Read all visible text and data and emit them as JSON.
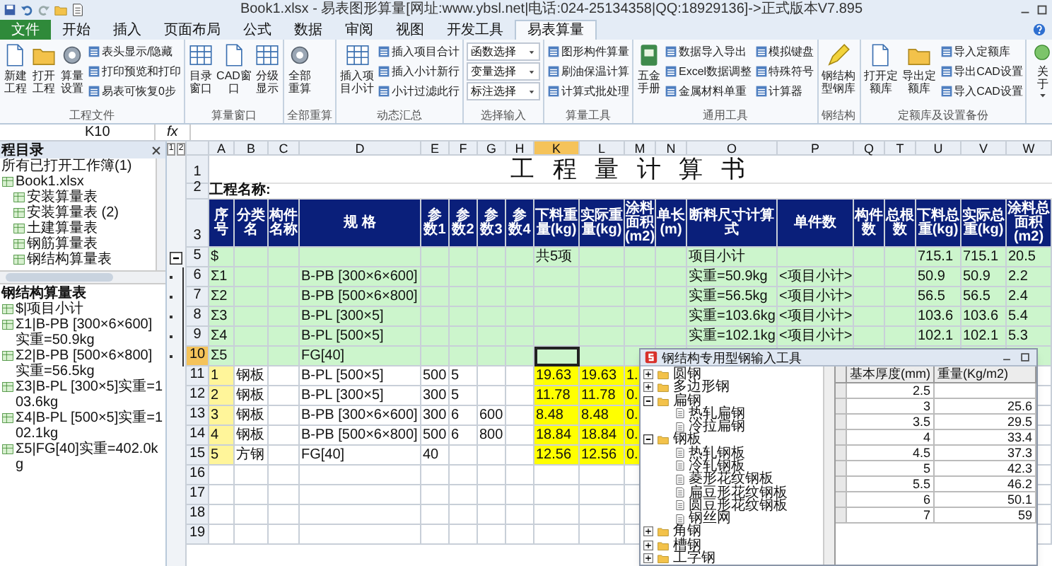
{
  "window": {
    "title": "Book1.xlsx - 易表图形算量[网址:www.ybsl.net|电话:024-25134358|QQ:18929136]->正式版本V7.895"
  },
  "tabs": [
    {
      "label": "文件",
      "kind": "file",
      "selected": false
    },
    {
      "label": "开始",
      "kind": "tab",
      "selected": false
    },
    {
      "label": "插入",
      "kind": "tab",
      "selected": false
    },
    {
      "label": "页面布局",
      "kind": "tab",
      "selected": false
    },
    {
      "label": "公式",
      "kind": "tab",
      "selected": false
    },
    {
      "label": "数据",
      "kind": "tab",
      "selected": false
    },
    {
      "label": "审阅",
      "kind": "tab",
      "selected": false
    },
    {
      "label": "视图",
      "kind": "tab",
      "selected": false
    },
    {
      "label": "开发工具",
      "kind": "tab",
      "selected": false
    },
    {
      "label": "易表算量",
      "kind": "tab",
      "selected": true
    }
  ],
  "ribbon": [
    {
      "label": "工程文件",
      "items": [
        {
          "kind": "large",
          "label": "新建工程"
        },
        {
          "kind": "large",
          "label": "打开工程"
        },
        {
          "kind": "large",
          "label": "算量设置"
        },
        {
          "kind": "small",
          "label": "表头显示/隐藏"
        },
        {
          "kind": "small",
          "label": "打印预览和打印"
        },
        {
          "kind": "small",
          "label": "易表可恢复0步"
        }
      ]
    },
    {
      "label": "算量窗口",
      "items": [
        {
          "kind": "large",
          "label": "目录窗口"
        },
        {
          "kind": "large",
          "label": "CAD窗口"
        },
        {
          "kind": "large",
          "label": "分级显示"
        }
      ]
    },
    {
      "label": "全部重算",
      "items": [
        {
          "kind": "large",
          "label": "全部重算"
        }
      ]
    },
    {
      "label": "动态汇总",
      "items": [
        {
          "kind": "large",
          "label": "插入项目小计"
        },
        {
          "kind": "small",
          "label": "插入项目合计"
        },
        {
          "kind": "small",
          "label": "插入小计新行"
        },
        {
          "kind": "small",
          "label": "小计过滤此行"
        }
      ]
    },
    {
      "label": "选择输入",
      "items": [
        {
          "kind": "select",
          "label": "函数选择"
        },
        {
          "kind": "select",
          "label": "变量选择"
        },
        {
          "kind": "select",
          "label": "标注选择"
        }
      ]
    },
    {
      "label": "算量工具",
      "items": [
        {
          "kind": "small",
          "label": "图形构件算量"
        },
        {
          "kind": "small",
          "label": "刷油保温计算"
        },
        {
          "kind": "small",
          "label": "计算式批处理"
        }
      ]
    },
    {
      "label": "通用工具",
      "items": [
        {
          "kind": "large",
          "label": "五金手册"
        },
        {
          "kind": "small",
          "label": "数据导入导出"
        },
        {
          "kind": "small",
          "label": "Excel数据调整"
        },
        {
          "kind": "small",
          "label": "金属材料单重"
        },
        {
          "kind": "small",
          "label": "模拟键盘"
        },
        {
          "kind": "small",
          "label": "特殊符号"
        },
        {
          "kind": "small",
          "label": "计算器"
        }
      ]
    },
    {
      "label": "钢结构",
      "items": [
        {
          "kind": "large",
          "label": "钢结构型钢库"
        }
      ]
    },
    {
      "label": "定额库及设置备份",
      "items": [
        {
          "kind": "large",
          "label": "打开定额库"
        },
        {
          "kind": "large",
          "label": "导出定额库"
        },
        {
          "kind": "small",
          "label": "导入定额库"
        },
        {
          "kind": "small",
          "label": "导出CAD设置"
        },
        {
          "kind": "small",
          "label": "导入CAD设置"
        }
      ]
    },
    {
      "items": [
        {
          "kind": "menu",
          "label": "关于"
        }
      ]
    }
  ],
  "formula_bar": {
    "name_box": "K10",
    "fx": "fx"
  },
  "panel": {
    "title": "程目录",
    "tree": {
      "label": "所有已打开工作簿(1)",
      "children": [
        {
          "label": "Book1.xlsx",
          "children": [
            {
              "label": "安装算量表"
            },
            {
              "label": "安装算量表 (2)"
            },
            {
              "label": "土建算量表"
            },
            {
              "label": "钢筋算量表"
            },
            {
              "label": "钢结构算量表"
            }
          ]
        }
      ]
    },
    "list_title": "钢结构算量表",
    "list": [
      "$|项目小计",
      "Σ1|B-PB [300×6×600]实重=50.9kg",
      "Σ2|B-PB [500×6×800]实重=56.5kg",
      "Σ3|B-PL [300×5]实重=103.6kg",
      "Σ4|B-PL [500×5]实重=102.1kg",
      "Σ5|FG[40]实重=402.0kg"
    ]
  },
  "outline": {
    "levels": [
      "1",
      "2"
    ]
  },
  "sheet": {
    "columns": [
      {
        "letter": "A",
        "selected": false
      },
      {
        "letter": "B",
        "selected": false
      },
      {
        "letter": "C",
        "selected": false
      },
      {
        "letter": "D",
        "selected": false
      },
      {
        "letter": "E",
        "selected": false
      },
      {
        "letter": "F",
        "selected": false
      },
      {
        "letter": "G",
        "selected": false
      },
      {
        "letter": "H",
        "selected": false
      },
      {
        "letter": "K",
        "selected": true
      },
      {
        "letter": "L",
        "selected": false
      },
      {
        "letter": "M",
        "selected": false
      },
      {
        "letter": "N",
        "selected": false
      },
      {
        "letter": "O",
        "selected": false
      },
      {
        "letter": "P",
        "selected": false
      },
      {
        "letter": "Q",
        "selected": false
      },
      {
        "letter": "T",
        "selected": false
      },
      {
        "letter": "U",
        "selected": false
      },
      {
        "letter": "V",
        "selected": false
      },
      {
        "letter": "W",
        "selected": false
      }
    ],
    "rows": [
      {
        "number": "1",
        "kind": "title",
        "selected": false,
        "text": "工 程 量 计 算 书"
      },
      {
        "number": "2",
        "kind": "project",
        "selected": false,
        "text": "工程名称:"
      },
      {
        "number": "3",
        "kind": "header",
        "selected": false,
        "cells": {
          "A": "序号",
          "B": "分类名",
          "C": "构件名称",
          "D": "规 格",
          "E": "参数1",
          "F": "参数2",
          "G": "参数3",
          "H": "参数4",
          "K": "下料重量(kg)",
          "L": "实际重量(kg)",
          "M": "涂料面积(m2)",
          "N": "单长(m)",
          "O": "断料尺寸计算式",
          "P": "单件数",
          "Q": "构件数",
          "T": "总根数",
          "U": "下料总重(kg)",
          "V": "实际总重(kg)",
          "W": "涂料总面积(m2)"
        }
      },
      {
        "number": "5",
        "kind": "summary",
        "selected": false,
        "cells": {
          "A": "$",
          "K": "共5项",
          "O": "项目小计",
          "U": "715.1",
          "V": "715.1",
          "W": "20.5"
        }
      },
      {
        "number": "6",
        "kind": "summary",
        "selected": false,
        "cells": {
          "A": "Σ1",
          "D": "B-PB [300×6×600]",
          "O": "实重=50.9kg",
          "P": "<项目小计>",
          "U": "50.9",
          "V": "50.9",
          "W": "2.2"
        }
      },
      {
        "number": "7",
        "kind": "summary",
        "selected": false,
        "cells": {
          "A": "Σ2",
          "D": "B-PB [500×6×800]",
          "O": "实重=56.5kg",
          "P": "<项目小计>",
          "U": "56.5",
          "V": "56.5",
          "W": "2.4"
        }
      },
      {
        "number": "8",
        "kind": "summary",
        "selected": false,
        "cells": {
          "A": "Σ3",
          "D": "B-PL [300×5]",
          "O": "实重=103.6kg",
          "P": "<项目小计>",
          "U": "103.6",
          "V": "103.6",
          "W": "5.4"
        }
      },
      {
        "number": "9",
        "kind": "summary",
        "selected": false,
        "cells": {
          "A": "Σ4",
          "D": "B-PL [500×5]",
          "O": "实重=102.1kg",
          "P": "<项目小计>",
          "U": "102.1",
          "V": "102.1",
          "W": "5.3"
        }
      },
      {
        "number": "10",
        "kind": "summary",
        "selected": true,
        "cells": {
          "A": "Σ5",
          "D": "FG[40]"
        }
      },
      {
        "number": "11",
        "kind": "item",
        "selected": false,
        "cells": {
          "A": "1",
          "B": "钢板",
          "D": "B-PL [500×5]",
          "E": "500",
          "F": "5",
          "K": "19.63",
          "L": "19.63",
          "M": "1."
        }
      },
      {
        "number": "12",
        "kind": "item",
        "selected": false,
        "cells": {
          "A": "2",
          "B": "钢板",
          "D": "B-PL [300×5]",
          "E": "300",
          "F": "5",
          "K": "11.78",
          "L": "11.78",
          "M": "0."
        }
      },
      {
        "number": "13",
        "kind": "item",
        "selected": false,
        "cells": {
          "A": "3",
          "B": "钢板",
          "D": "B-PB [300×6×600]",
          "E": "300",
          "F": "6",
          "G": "600",
          "K": "8.48",
          "L": "8.48",
          "M": "0."
        }
      },
      {
        "number": "14",
        "kind": "item",
        "selected": false,
        "cells": {
          "A": "4",
          "B": "钢板",
          "D": "B-PB [500×6×800]",
          "E": "500",
          "F": "6",
          "G": "800",
          "K": "18.84",
          "L": "18.84",
          "M": "0."
        }
      },
      {
        "number": "15",
        "kind": "item",
        "selected": false,
        "cells": {
          "A": "5",
          "B": "方钢",
          "D": "FG[40]",
          "E": "40",
          "K": "12.56",
          "L": "12.56",
          "M": "0."
        }
      },
      {
        "number": "16",
        "kind": "empty",
        "selected": false
      },
      {
        "number": "17",
        "kind": "empty",
        "selected": false
      },
      {
        "number": "18",
        "kind": "empty",
        "selected": false
      },
      {
        "number": "19",
        "kind": "empty",
        "selected": false
      }
    ]
  },
  "dialog": {
    "title": "钢结构专用型钢输入工具",
    "tree": [
      {
        "label": "圆钢",
        "expanded": false
      },
      {
        "label": "多边形钢",
        "expanded": false
      },
      {
        "label": "扁钢",
        "expanded": true,
        "children": [
          {
            "label": "热轧扁钢"
          },
          {
            "label": "冷拉扁钢"
          }
        ]
      },
      {
        "label": "钢板",
        "expanded": true,
        "children": [
          {
            "label": "热轧钢板"
          },
          {
            "label": "冷轧钢板"
          },
          {
            "label": "菱形花纹钢板"
          },
          {
            "label": "扁豆形花纹钢板"
          },
          {
            "label": "圆豆形花纹钢板"
          },
          {
            "label": "钢丝网"
          }
        ]
      },
      {
        "label": "角钢",
        "expanded": false
      },
      {
        "label": "槽钢",
        "expanded": false
      },
      {
        "label": "工字钢",
        "expanded": false
      }
    ],
    "columns": [
      "基本厚度(mm)",
      "重量(Kg/m2)"
    ],
    "rows": [
      {
        "thickness": "2.5"
      },
      {
        "thickness": "3",
        "weight": "25.6"
      },
      {
        "thickness": "3.5",
        "weight": "29.5"
      },
      {
        "thickness": "4",
        "weight": "33.4"
      },
      {
        "thickness": "4.5",
        "weight": "37.3"
      },
      {
        "thickness": "5",
        "weight": "42.3"
      },
      {
        "thickness": "5.5",
        "weight": "46.2"
      },
      {
        "thickness": "6",
        "weight": "50.1"
      },
      {
        "thickness": "7",
        "weight": "59"
      }
    ]
  }
}
